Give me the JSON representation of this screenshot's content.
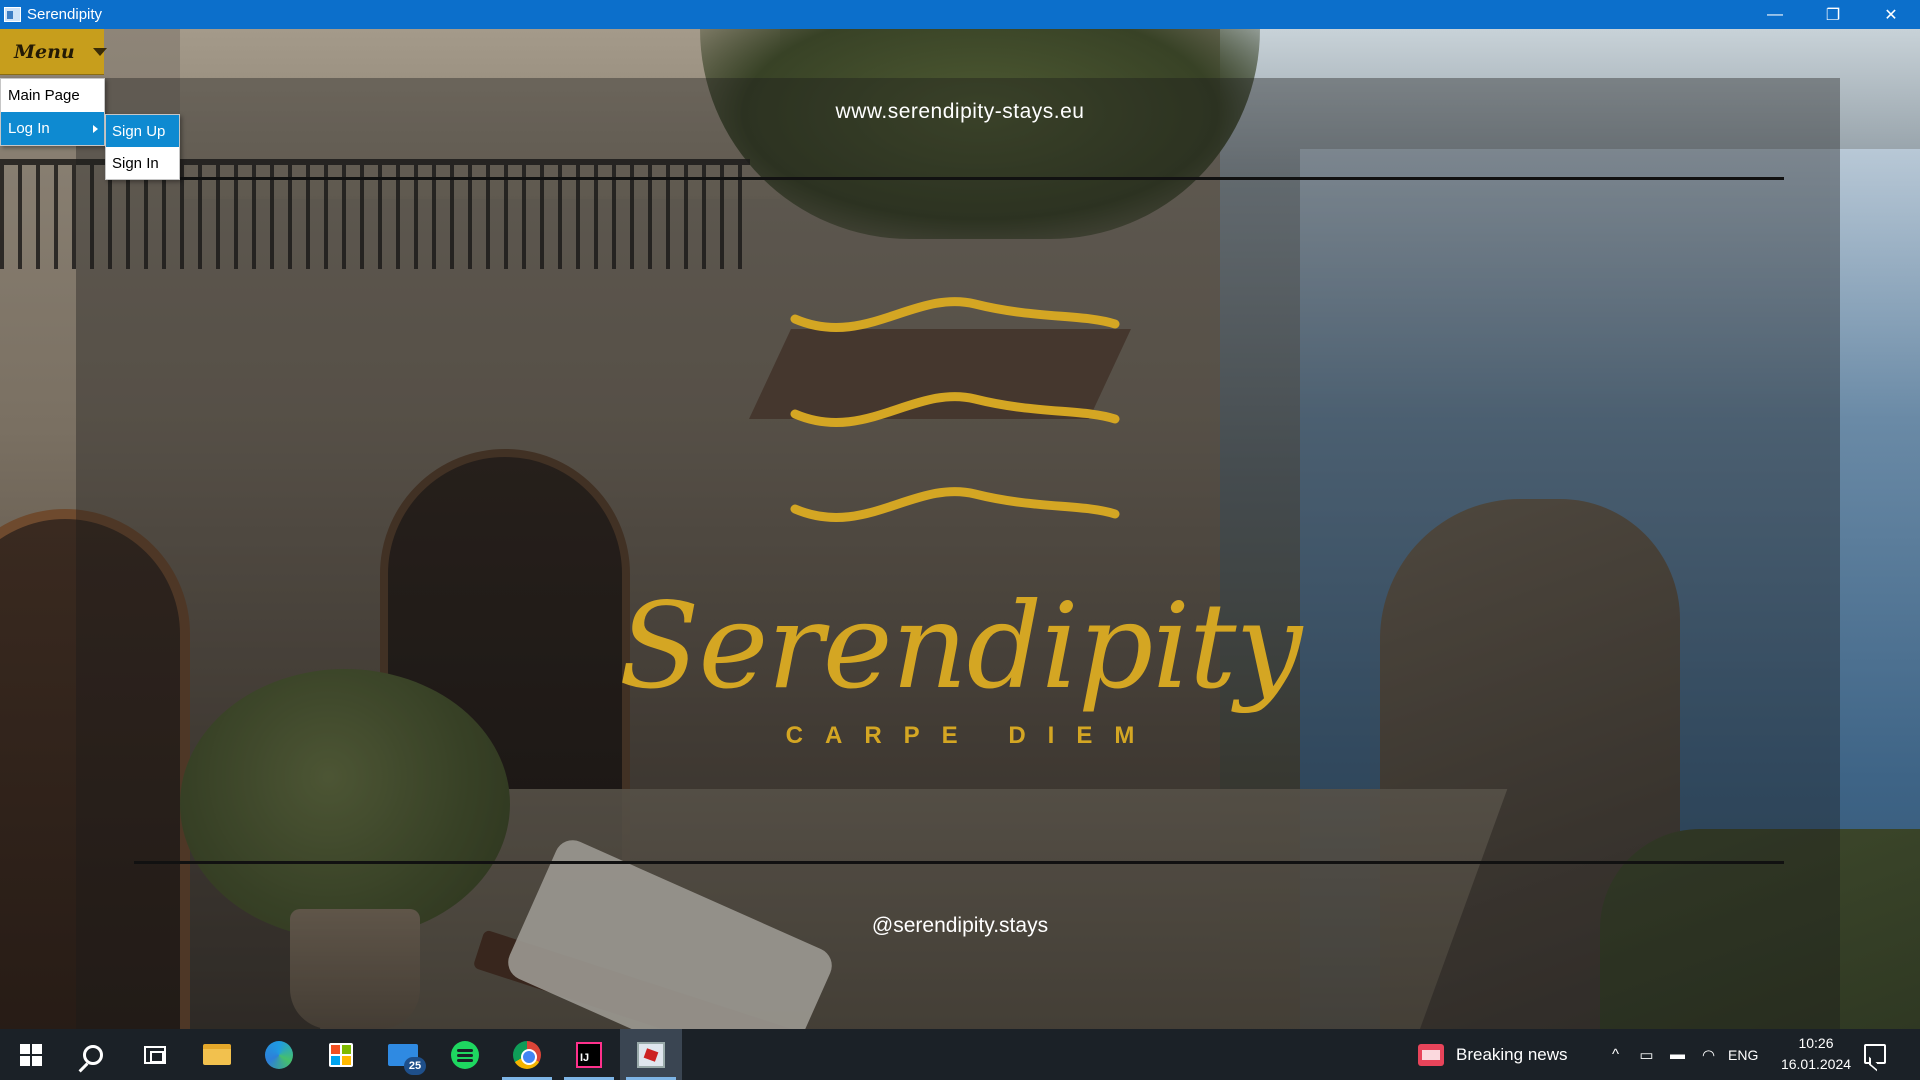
{
  "window": {
    "title": "Serendipity",
    "controls": {
      "minimize_icon": "—",
      "restore_icon": "❐",
      "close_icon": "✕"
    }
  },
  "menu": {
    "button_label": "Menu",
    "items": [
      {
        "label": "Main Page",
        "active": false
      },
      {
        "label": "Log In",
        "active": true,
        "has_submenu": true
      }
    ],
    "submenu": [
      {
        "label": "Sign Up",
        "active": true
      },
      {
        "label": "Sign In",
        "active": false
      }
    ]
  },
  "hero": {
    "website": "www.serendipity-stays.eu",
    "brand_name": "Serendipity",
    "tagline": "CARPE DIEM",
    "social_handle": "@serendipity.stays",
    "accent_color": "#d4a623"
  },
  "taskbar": {
    "apps": [
      {
        "name": "start-icon"
      },
      {
        "name": "search-icon"
      },
      {
        "name": "task-view-icon"
      },
      {
        "name": "file-explorer-icon"
      },
      {
        "name": "edge-icon"
      },
      {
        "name": "store-icon"
      },
      {
        "name": "mail-icon",
        "badge": "25"
      },
      {
        "name": "spotify-icon"
      },
      {
        "name": "chrome-icon"
      },
      {
        "name": "intellij-icon"
      },
      {
        "name": "serendipity-app-icon",
        "active": true
      }
    ],
    "news_label": "Breaking news",
    "tray": {
      "chevron": "^",
      "language": "ENG",
      "time": "10:26",
      "date": "16.01.2024"
    }
  }
}
